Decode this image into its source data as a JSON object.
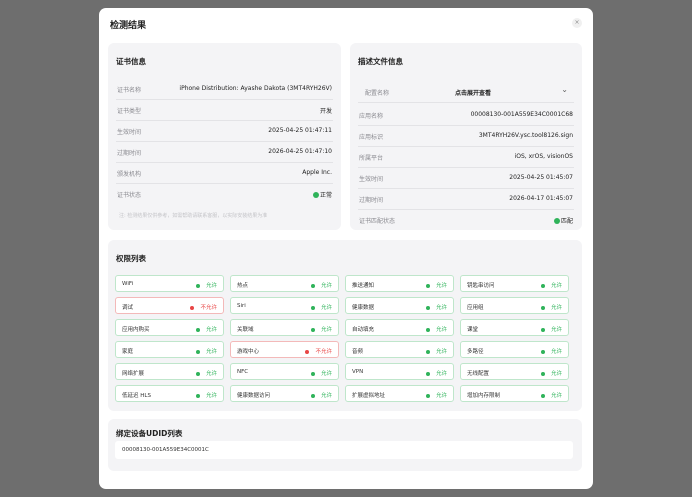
{
  "modal": {
    "title": "检测结果",
    "close_icon": "×"
  },
  "certificate": {
    "title": "证书信息",
    "rows": [
      {
        "key": "证书名称",
        "value": "iPhone Distribution: Ayashe Dakota (3MT4RYH26V)"
      },
      {
        "key": "证书类型",
        "value": "开发"
      },
      {
        "key": "生效时间",
        "value": "2025-04-25 01:47:11"
      },
      {
        "key": "过期时间",
        "value": "2026-04-25 01:47:10"
      },
      {
        "key": "颁发机构",
        "value": "Apple Inc."
      },
      {
        "key": "证书状态",
        "value": "正常"
      }
    ],
    "note": "注: 检测结果仅供参考，如需帮助请联系客服，以实际安装结果为准"
  },
  "profile": {
    "title": "描述文件信息",
    "select_key": "配置名称",
    "select_value": "点击展开查看",
    "rows": [
      {
        "key": "应用名称",
        "value": "00008130-001A559E34C0001C68"
      },
      {
        "key": "应用标识",
        "value": "3MT4RYH26V.ysc.tool8126.sign"
      },
      {
        "key": "所属平台",
        "value": "iOS, xrOS, visionOS"
      },
      {
        "key": "生效时间",
        "value": "2025-04-25 01:45:07"
      },
      {
        "key": "过期时间",
        "value": "2026-04-17 01:45:07"
      },
      {
        "key": "证书匹配状态",
        "value": "匹配"
      }
    ]
  },
  "permissions": {
    "title": "权限列表",
    "items": [
      {
        "name": "WiFi",
        "status": "允许",
        "allowed": true
      },
      {
        "name": "热点",
        "status": "允许",
        "allowed": true
      },
      {
        "name": "推送通知",
        "status": "允许",
        "allowed": true
      },
      {
        "name": "钥匙串访问",
        "status": "允许",
        "allowed": true
      },
      {
        "name": "调试",
        "status": "不允许",
        "allowed": false
      },
      {
        "name": "Siri",
        "status": "允许",
        "allowed": true
      },
      {
        "name": "健康数据",
        "status": "允许",
        "allowed": true
      },
      {
        "name": "应用组",
        "status": "允许",
        "allowed": true
      },
      {
        "name": "应用内购买",
        "status": "允许",
        "allowed": true
      },
      {
        "name": "关联域",
        "status": "允许",
        "allowed": true
      },
      {
        "name": "自动填充",
        "status": "允许",
        "allowed": true
      },
      {
        "name": "课堂",
        "status": "允许",
        "allowed": true
      },
      {
        "name": "家庭",
        "status": "允许",
        "allowed": true
      },
      {
        "name": "游戏中心",
        "status": "不允许",
        "allowed": false
      },
      {
        "name": "音频",
        "status": "允许",
        "allowed": true
      },
      {
        "name": "多路径",
        "status": "允许",
        "allowed": true
      },
      {
        "name": "网络扩展",
        "status": "允许",
        "allowed": true
      },
      {
        "name": "NFC",
        "status": "允许",
        "allowed": true
      },
      {
        "name": "VPN",
        "status": "允许",
        "allowed": true
      },
      {
        "name": "无线配置",
        "status": "允许",
        "allowed": true
      },
      {
        "name": "低延迟 HLS",
        "status": "允许",
        "allowed": true
      },
      {
        "name": "健康数据访问",
        "status": "允许",
        "allowed": true
      },
      {
        "name": "扩展虚拟地址",
        "status": "允许",
        "allowed": true
      },
      {
        "name": "增加内存限制",
        "status": "允许",
        "allowed": true
      }
    ]
  },
  "udid": {
    "title": "绑定设备UDID列表",
    "items": [
      "00008130-001A559E34C0001C"
    ]
  },
  "colors": {
    "ok": "#2fb35a",
    "denied": "#e84545",
    "backdrop": "#6e6e6e"
  }
}
